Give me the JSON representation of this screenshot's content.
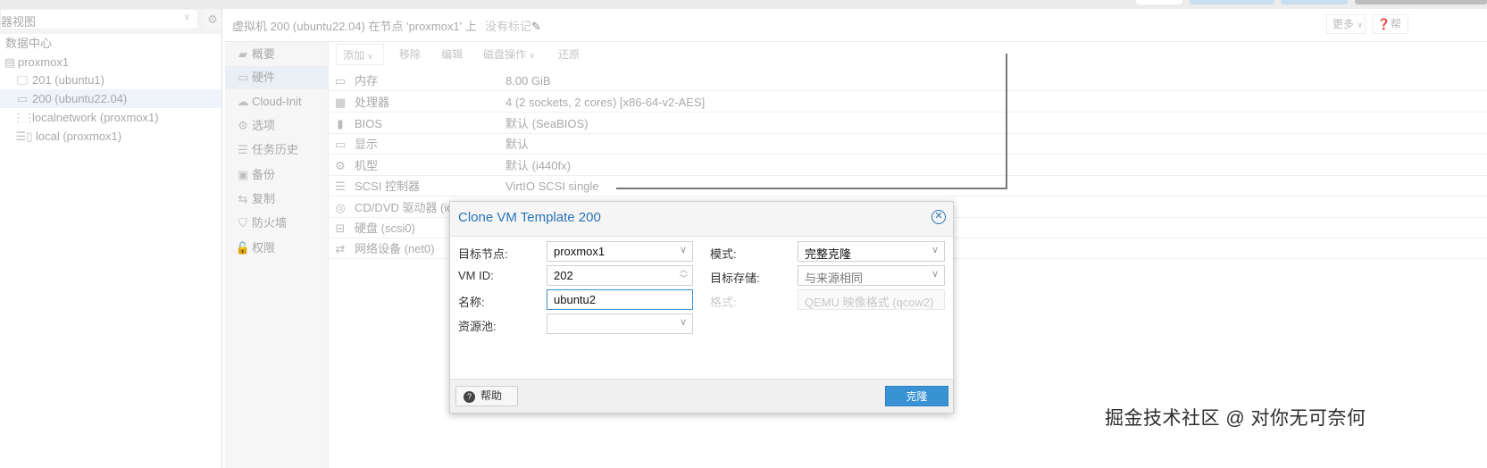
{
  "top": {
    "buttons_colors": [
      "#ffffff",
      "#c7dff0",
      "#c7dff0",
      "#bdbdbd"
    ]
  },
  "left": {
    "view_select": "器视图",
    "tree": [
      {
        "label": "数据中心",
        "icon": "datacenter"
      },
      {
        "label": "proxmox1",
        "icon": "server-online-icon"
      },
      {
        "label": "201 (ubuntu1)",
        "icon": "vm-running-icon"
      },
      {
        "label": "200 (ubuntu22.04)",
        "icon": "vm-template-icon",
        "selected": true
      },
      {
        "label": "localnetwork (proxmox1)",
        "icon": "network-grid-icon"
      },
      {
        "label": "local (proxmox1)",
        "icon": "storage-icon"
      }
    ]
  },
  "header": {
    "title": "虚拟机 200 (ubuntu22.04) 在节点 'proxmox1' 上",
    "tags": "没有标记",
    "more": "更多",
    "help": "帮"
  },
  "nav": [
    {
      "label": "概要",
      "icon": "book-icon"
    },
    {
      "label": "硬件",
      "icon": "monitor-icon",
      "selected": true
    },
    {
      "label": "Cloud-Init",
      "icon": "cloud-icon"
    },
    {
      "label": "选项",
      "icon": "gear-icon"
    },
    {
      "label": "任务历史",
      "icon": "list-icon"
    },
    {
      "label": "备份",
      "icon": "floppy-icon"
    },
    {
      "label": "复制",
      "icon": "retweet-icon"
    },
    {
      "label": "防火墙",
      "icon": "shield-icon"
    },
    {
      "label": "权限",
      "icon": "unlock-icon"
    }
  ],
  "toolbar": {
    "add": "添加",
    "remove": "移除",
    "edit": "编辑",
    "disk_action": "磁盘操作",
    "revert": "还原"
  },
  "hardware": [
    {
      "key": "内存",
      "value": "8.00 GiB",
      "icon": "memory-icon"
    },
    {
      "key": "处理器",
      "value": "4 (2 sockets, 2 cores) [x86-64-v2-AES]",
      "icon": "cpu-icon"
    },
    {
      "key": "BIOS",
      "value": "默认 (SeaBIOS)",
      "icon": "bios-icon"
    },
    {
      "key": "显示",
      "value": "默认",
      "icon": "monitor-icon"
    },
    {
      "key": "机型",
      "value": "默认 (i440fx)",
      "icon": "cogs-icon"
    },
    {
      "key": "SCSI 控制器",
      "value": "VirtIO SCSI single",
      "icon": "database-icon"
    },
    {
      "key": "CD/DVD 驱动器 (ide",
      "value": "",
      "icon": "cdrom-icon"
    },
    {
      "key": "硬盘 (scsi0)",
      "value": "",
      "icon": "hdd-icon"
    },
    {
      "key": "网络设备 (net0)",
      "value": "",
      "icon": "exchange-icon"
    }
  ],
  "dialog": {
    "title": "Clone VM Template 200",
    "target_node_label": "目标节点:",
    "target_node": "proxmox1",
    "vmid_label": "VM ID:",
    "vmid": "202",
    "name_label": "名称:",
    "name": "ubuntu2",
    "pool_label": "资源池:",
    "pool": "",
    "mode_label": "模式:",
    "mode": "完整克隆",
    "storage_label": "目标存储:",
    "storage": "与来源相同",
    "format_label": "格式:",
    "format": "QEMU 映像格式 (qcow2)",
    "help": "帮助",
    "clone": "克隆",
    "accent": "#3892d4"
  },
  "watermark": "掘金技术社区 @ 对你无可奈何"
}
